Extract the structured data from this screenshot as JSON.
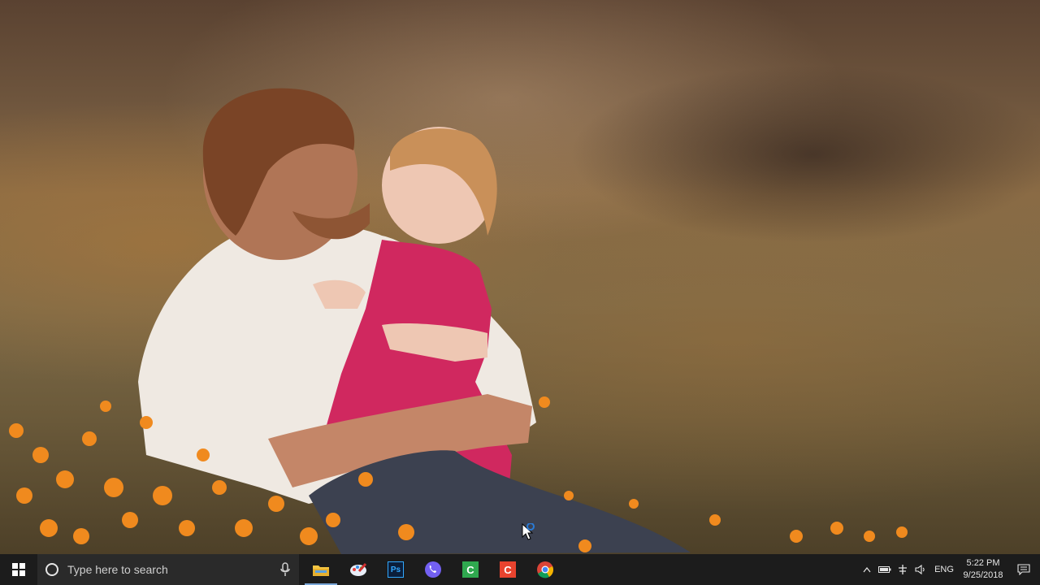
{
  "taskbar": {
    "search": {
      "placeholder": "Type here to search"
    },
    "apps": [
      {
        "name": "File Explorer",
        "icon": "folder-icon",
        "running": true
      },
      {
        "name": "Paint",
        "icon": "paint-icon",
        "running": false
      },
      {
        "name": "Photoshop",
        "icon": "photoshop-icon",
        "label": "Ps",
        "running": false
      },
      {
        "name": "Viber",
        "icon": "viber-icon",
        "running": false
      },
      {
        "name": "Camtasia Recorder",
        "icon": "camtasia-green-icon",
        "label": "C",
        "running": false
      },
      {
        "name": "Camtasia",
        "icon": "camtasia-red-icon",
        "label": "C",
        "running": false
      },
      {
        "name": "Chrome",
        "icon": "chrome-icon",
        "running": false
      }
    ],
    "tray": {
      "language": "ENG",
      "time": "5:22 PM",
      "date": "9/25/2018"
    }
  },
  "colors": {
    "taskbar_bg": "#1c1c1c",
    "search_bg": "#2a2a2a",
    "windows_accent": "#ffffff"
  }
}
